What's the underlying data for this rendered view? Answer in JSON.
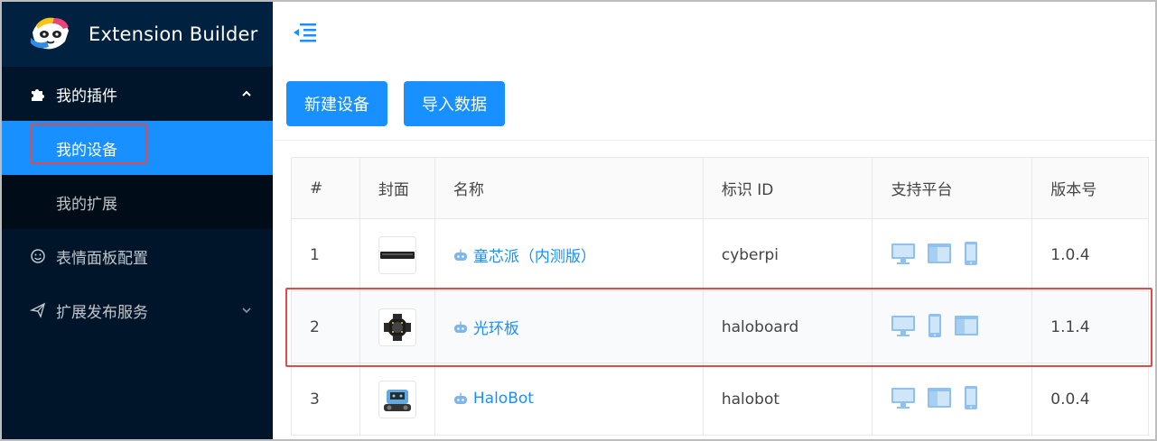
{
  "app": {
    "title": "Extension Builder"
  },
  "sidebar": {
    "groups": [
      {
        "label": "我的插件",
        "open": true,
        "children": [
          {
            "label": "我的设备",
            "active": true
          },
          {
            "label": "我的扩展",
            "active": false
          }
        ]
      },
      {
        "label": "表情面板配置"
      },
      {
        "label": "扩展发布服务"
      }
    ]
  },
  "toolbar": {
    "new_device": "新建设备",
    "import_data": "导入数据"
  },
  "table": {
    "headers": [
      "#",
      "封面",
      "名称",
      "标识 ID",
      "支持平台",
      "版本号"
    ],
    "rows": [
      {
        "index": "1",
        "name": "童芯派（内测版）",
        "id": "cyberpi",
        "platforms": [
          "desktop-icon",
          "web-icon",
          "mobile-icon"
        ],
        "version": "1.0.4"
      },
      {
        "index": "2",
        "name": "光环板",
        "id": "haloboard",
        "platforms": [
          "desktop-icon",
          "mobile-icon",
          "web-icon"
        ],
        "version": "1.1.4"
      },
      {
        "index": "3",
        "name": "HaloBot",
        "id": "halobot",
        "platforms": [
          "desktop-icon",
          "web-icon",
          "mobile-icon"
        ],
        "version": "0.0.4"
      }
    ]
  },
  "colors": {
    "sidebar_bg": "#001529",
    "accent": "#1890ff",
    "highlight": "#e04b4b"
  }
}
